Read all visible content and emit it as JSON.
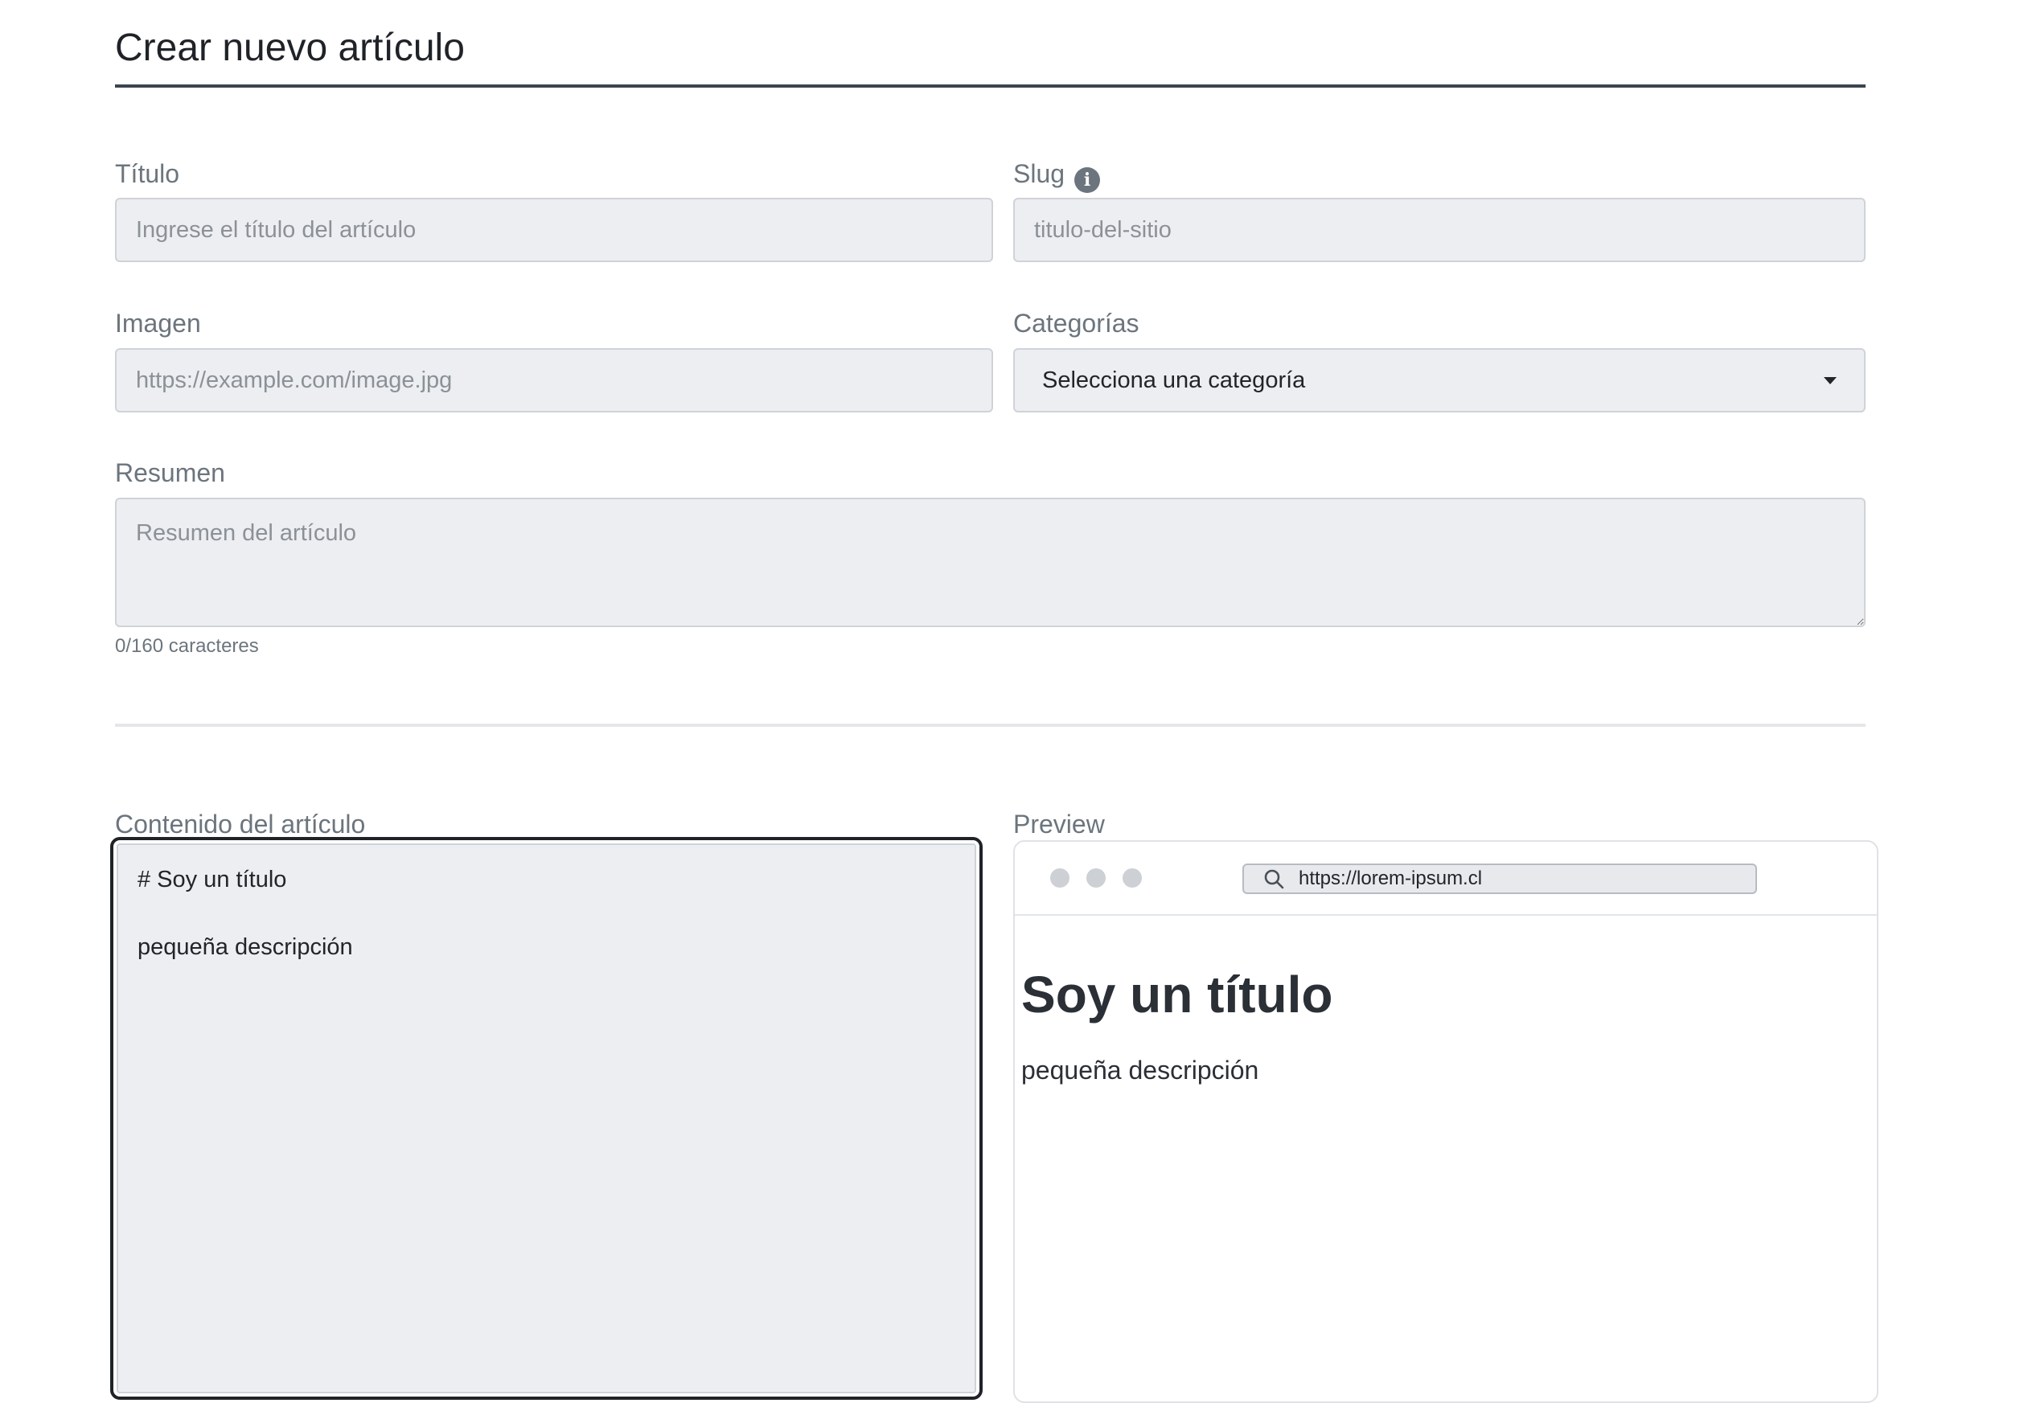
{
  "page": {
    "title": "Crear nuevo artículo"
  },
  "form": {
    "titulo": {
      "label": "Título",
      "placeholder": "Ingrese el título del artículo",
      "value": ""
    },
    "slug": {
      "label": "Slug",
      "info_icon": "info-icon",
      "placeholder": "titulo-del-sitio",
      "value": ""
    },
    "imagen": {
      "label": "Imagen",
      "placeholder": "https://example.com/image.jpg",
      "value": ""
    },
    "categorias": {
      "label": "Categorías",
      "selected": "Selecciona una categoría"
    },
    "resumen": {
      "label": "Resumen",
      "placeholder": "Resumen del artículo",
      "value": "",
      "char_count": "0/160 caracteres"
    }
  },
  "editor": {
    "label": "Contenido del artículo",
    "lines": [
      "# Soy un título",
      "",
      "pequeña descripción"
    ]
  },
  "preview": {
    "label": "Preview",
    "url": "https://lorem-ipsum.cl",
    "heading": "Soy un título",
    "paragraph": "pequeña descripción"
  }
}
